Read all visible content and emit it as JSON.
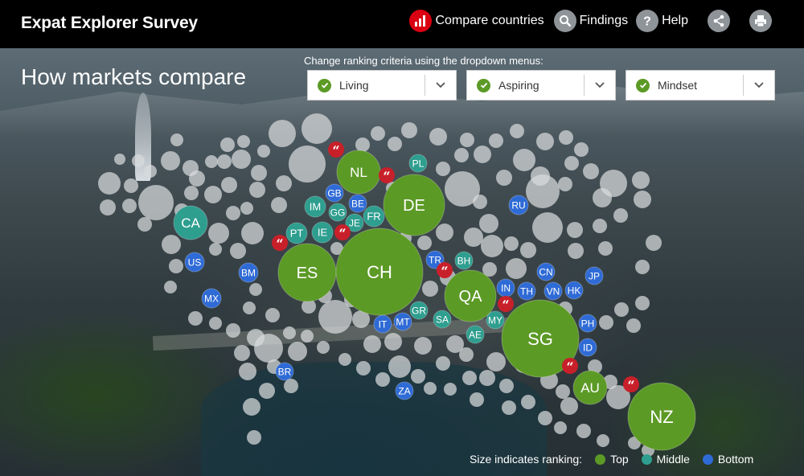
{
  "header": {
    "title": "Expat Explorer Survey",
    "nav": [
      {
        "label": "Compare countries",
        "icon": "bar-chart-icon"
      },
      {
        "label": "Findings",
        "icon": "magnifier-icon"
      },
      {
        "label": "Help",
        "icon": "question-icon"
      }
    ],
    "share_icon": "share-icon",
    "print_icon": "print-icon"
  },
  "main": {
    "title": "How markets compare",
    "criteria_prompt": "Change ranking criteria using the dropdown menus:",
    "dropdowns": [
      {
        "selected": "Living"
      },
      {
        "selected": "Aspiring"
      },
      {
        "selected": "Mindset"
      }
    ]
  },
  "legend": {
    "label": "Size indicates ranking:",
    "items": [
      {
        "label": "Top",
        "color": "#5c9a26"
      },
      {
        "label": "Middle",
        "color": "#2e9e8f"
      },
      {
        "label": "Bottom",
        "color": "#2f6bd6"
      }
    ]
  },
  "colors": {
    "top": "#5c9a26",
    "middle": "#2e9e8f",
    "bottom": "#2f6bd6",
    "quote": "#c8202a",
    "inactive": "#d8dbdd"
  },
  "countries": [
    {
      "code": "NL",
      "rank": "top"
    },
    {
      "code": "DE",
      "rank": "top"
    },
    {
      "code": "ES",
      "rank": "top"
    },
    {
      "code": "CH",
      "rank": "top"
    },
    {
      "code": "QA",
      "rank": "top"
    },
    {
      "code": "SG",
      "rank": "top"
    },
    {
      "code": "AU",
      "rank": "top"
    },
    {
      "code": "NZ",
      "rank": "top"
    },
    {
      "code": "CA",
      "rank": "middle"
    },
    {
      "code": "IM",
      "rank": "middle"
    },
    {
      "code": "GG",
      "rank": "middle"
    },
    {
      "code": "JE",
      "rank": "middle"
    },
    {
      "code": "FR",
      "rank": "middle"
    },
    {
      "code": "PT",
      "rank": "middle"
    },
    {
      "code": "IE",
      "rank": "middle"
    },
    {
      "code": "PL",
      "rank": "middle"
    },
    {
      "code": "BH",
      "rank": "middle"
    },
    {
      "code": "GR",
      "rank": "middle"
    },
    {
      "code": "SA",
      "rank": "middle"
    },
    {
      "code": "AE",
      "rank": "middle"
    },
    {
      "code": "MY",
      "rank": "middle"
    },
    {
      "code": "GB",
      "rank": "bottom"
    },
    {
      "code": "BE",
      "rank": "bottom"
    },
    {
      "code": "RU",
      "rank": "bottom"
    },
    {
      "code": "US",
      "rank": "bottom"
    },
    {
      "code": "BM",
      "rank": "bottom"
    },
    {
      "code": "MX",
      "rank": "bottom"
    },
    {
      "code": "TR",
      "rank": "bottom"
    },
    {
      "code": "IN",
      "rank": "bottom"
    },
    {
      "code": "TH",
      "rank": "bottom"
    },
    {
      "code": "VN",
      "rank": "bottom"
    },
    {
      "code": "HK",
      "rank": "bottom"
    },
    {
      "code": "CN",
      "rank": "bottom"
    },
    {
      "code": "JP",
      "rank": "bottom"
    },
    {
      "code": "IT",
      "rank": "bottom"
    },
    {
      "code": "MT",
      "rank": "bottom"
    },
    {
      "code": "PH",
      "rank": "bottom"
    },
    {
      "code": "ID",
      "rank": "bottom"
    },
    {
      "code": "BR",
      "rank": "bottom"
    },
    {
      "code": "ZA",
      "rank": "bottom"
    }
  ],
  "quote_markers": 9
}
